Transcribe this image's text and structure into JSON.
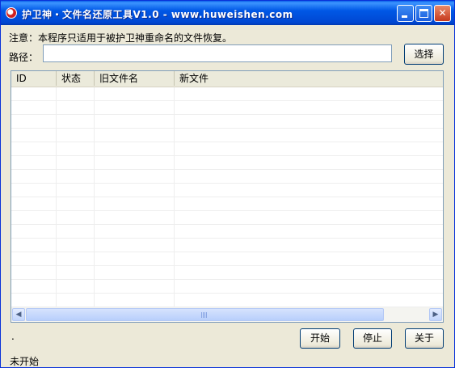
{
  "window": {
    "title": "护卫神・文件名还原工具V1.0 - www.huweishen.com",
    "controls": {
      "minimize_icon": "minimize-icon",
      "maximize_icon": "maximize-icon",
      "close_icon": "close-icon",
      "close_glyph": "✕"
    }
  },
  "notice": "注意：本程序只适用于被护卫神重命名的文件恢复。",
  "path": {
    "label": "路径：",
    "value": "",
    "placeholder": ""
  },
  "select_button": "选择",
  "table": {
    "columns": [
      "ID",
      "状态",
      "旧文件名",
      "新文件"
    ],
    "rows": []
  },
  "scrollbar": {
    "left_arrow": "◀",
    "right_arrow": "▶"
  },
  "footer": {
    "left_text": ".",
    "start_button": "开始",
    "stop_button": "停止",
    "about_button": "关于"
  },
  "status": "未开始"
}
